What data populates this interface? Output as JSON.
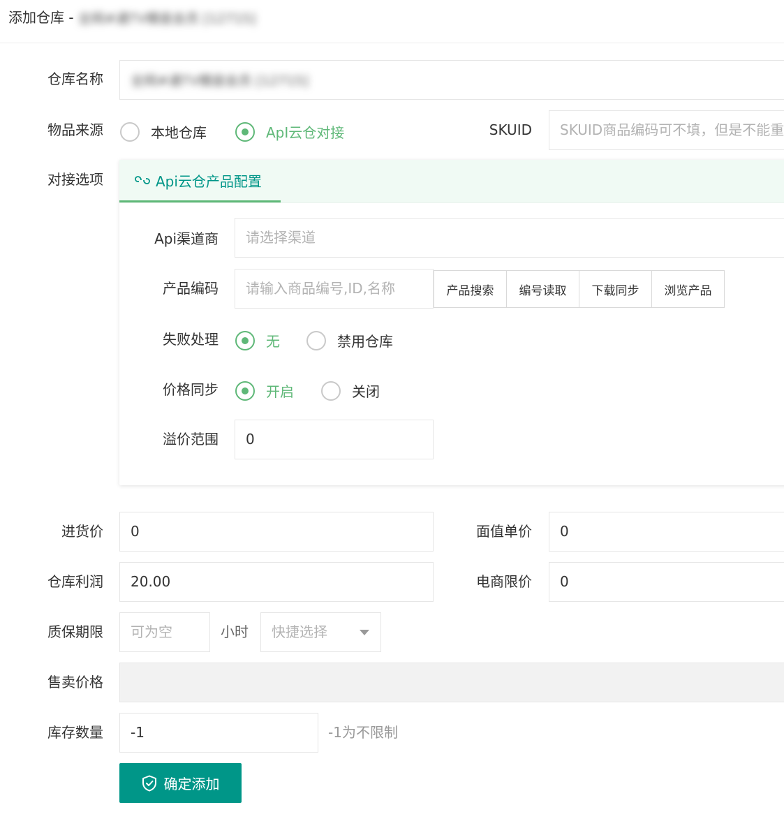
{
  "header": {
    "title": "添加仓库 -",
    "blurred_name": "全网#通TV模座会员 [12715]"
  },
  "form": {
    "warehouse_name": {
      "label": "仓库名称",
      "value": "全网#通TV模座会员 [12715]"
    },
    "source": {
      "label": "物品来源",
      "options": [
        "本地仓库",
        "ApI云仓对接"
      ],
      "selected": "ApI云仓对接"
    },
    "skuid": {
      "label": "SKUID",
      "placeholder": "SKUID商品编码可不填，但是不能重复"
    },
    "docking": {
      "label": "对接选项"
    },
    "purchase_price": {
      "label": "进货价",
      "value": "0"
    },
    "face_value": {
      "label": "面值单价",
      "value": "0"
    },
    "profit": {
      "label": "仓库利润",
      "value": "20.00"
    },
    "ecommerce_limit": {
      "label": "电商限价",
      "value": "0"
    },
    "warranty": {
      "label": "质保期限",
      "placeholder": "可为空",
      "unit": "小时",
      "quick_select": "快捷选择"
    },
    "sale_price": {
      "label": "售卖价格",
      "value": ""
    },
    "stock": {
      "label": "库存数量",
      "value": "-1",
      "hint": "-1为不限制"
    },
    "submit_label": "确定添加"
  },
  "api_card": {
    "tab_label": "Api云仓产品配置",
    "channel": {
      "label": "Api渠道商",
      "placeholder": "请选择渠道"
    },
    "product_code": {
      "label": "产品编码",
      "placeholder": "请输入商品编号,ID,名称",
      "buttons": [
        "产品搜索",
        "编号读取",
        "下载同步",
        "浏览产品"
      ]
    },
    "failure": {
      "label": "失败处理",
      "options": [
        "无",
        "禁用仓库"
      ],
      "selected": "无"
    },
    "price_sync": {
      "label": "价格同步",
      "options": [
        "开启",
        "关闭"
      ],
      "selected": "开启"
    },
    "premium": {
      "label": "溢价范围",
      "value": "0"
    }
  },
  "colors": {
    "accent": "#5fb878",
    "primary": "#009688"
  }
}
